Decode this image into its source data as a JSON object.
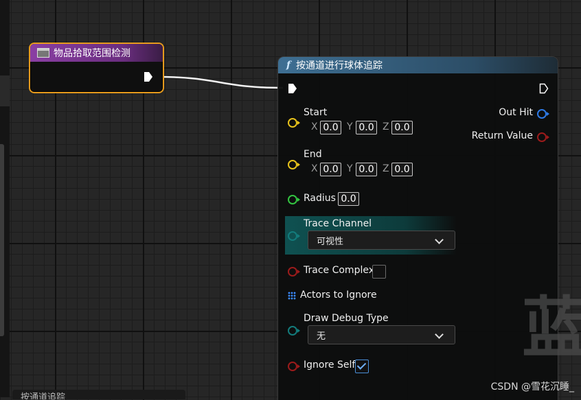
{
  "event_node": {
    "title": "物品拾取范围检测"
  },
  "function_node": {
    "title": "按通道进行球体追踪",
    "start": {
      "label": "Start",
      "x_label": "X",
      "y_label": "Y",
      "z_label": "Z",
      "x": "0.0",
      "y": "0.0",
      "z": "0.0"
    },
    "end": {
      "label": "End",
      "x_label": "X",
      "y_label": "Y",
      "z_label": "Z",
      "x": "0.0",
      "y": "0.0",
      "z": "0.0"
    },
    "radius": {
      "label": "Radius",
      "value": "0.0"
    },
    "trace_channel": {
      "label": "Trace Channel",
      "selected": "可视性"
    },
    "trace_complex": {
      "label": "Trace Complex",
      "checked": false
    },
    "actors_to_ignore": {
      "label": "Actors to Ignore"
    },
    "draw_debug_type": {
      "label": "Draw Debug Type",
      "selected": "无"
    },
    "ignore_self": {
      "label": "Ignore Self",
      "checked": true
    },
    "outputs": {
      "out_hit": "Out Hit",
      "return_value": "Return Value"
    }
  },
  "watermark": {
    "char": "蓝"
  },
  "credit": "CSDN @雪花沉睡_",
  "bottom_tab": {
    "label": "按通道追踪"
  },
  "colors": {
    "event_header": "#8a3fa3",
    "event_border": "#e79b1c",
    "function_header": "#3e6f93",
    "vector_pin": "#e8c31b",
    "float_pin": "#33c441",
    "enum_pin": "#137c7c",
    "bool_pin": "#9c1b1b",
    "struct_pin": "#2e7ae6"
  }
}
